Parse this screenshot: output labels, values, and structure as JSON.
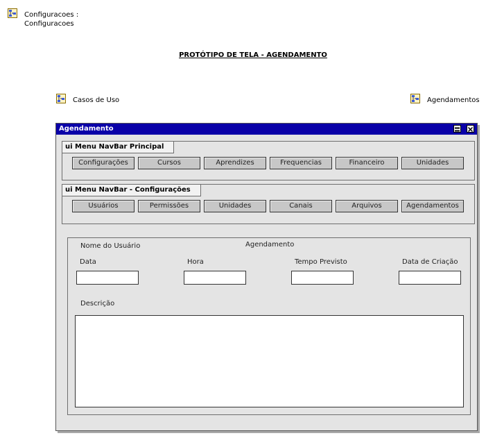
{
  "header": {
    "link_line1": "Configuracoes :",
    "link_line2": "Configuracoes",
    "page_title": "PROTÓTIPO DE TELA - AGENDAMENTO"
  },
  "links": {
    "use_cases": "Casos de Uso",
    "schedules": "Agendamentos"
  },
  "window": {
    "title": "Agendamento"
  },
  "nav_main": {
    "title": "ui Menu NavBar Principal",
    "buttons": [
      "Configurações",
      "Cursos",
      "Aprendizes",
      "Frequencias",
      "Financeiro",
      "Unidades"
    ]
  },
  "nav_config": {
    "title": "ui Menu NavBar - Configurações",
    "buttons": [
      "Usuários",
      "Permissões",
      "Unidades",
      "Canais",
      "Arquivos",
      "Agendamentos"
    ]
  },
  "form": {
    "user_name_label": "Nome do Usuário",
    "heading": "Agendamento",
    "date_label": "Data",
    "time_label": "Hora",
    "expected_time_label": "Tempo Previsto",
    "creation_date_label": "Data de Criação",
    "description_label": "Descrição",
    "date_value": "",
    "time_value": "",
    "expected_time_value": "",
    "creation_date_value": "",
    "description_value": ""
  }
}
